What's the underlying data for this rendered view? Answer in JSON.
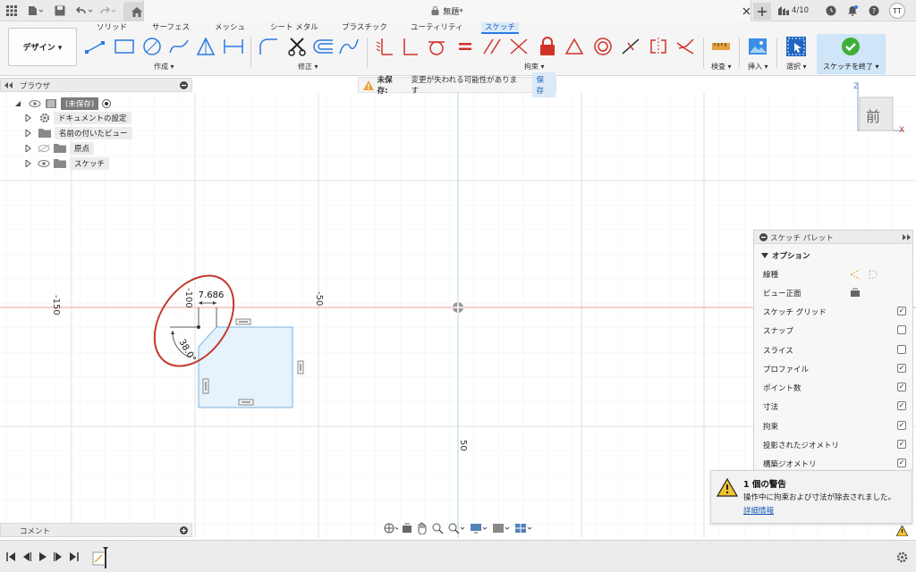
{
  "titlebar": {
    "document_title": "無題*",
    "job_counter": "4/10",
    "user_initials": "TT"
  },
  "ribbon": {
    "tabs": [
      "ソリッド",
      "サーフェス",
      "メッシュ",
      "シート メタル",
      "プラスチック",
      "ユーティリティ",
      "スケッチ"
    ],
    "active_tab": "スケッチ",
    "workspace_label": "デザイン ▾",
    "groups": {
      "create": "作成 ▾",
      "modify": "修正 ▾",
      "constraints": "拘束 ▾",
      "inspect": "検査 ▾",
      "insert": "挿入 ▾",
      "select": "選択 ▾",
      "finish": "スケッチを終了 ▾"
    }
  },
  "browser": {
    "title": "ブラウザ",
    "items": [
      {
        "label": "(未保存)"
      },
      {
        "label": "ドキュメントの設定"
      },
      {
        "label": "名前の付いたビュー"
      },
      {
        "label": "原点"
      },
      {
        "label": "スケッチ"
      }
    ]
  },
  "unsaved_bar": {
    "label": "未保存:",
    "message": "変更が失われる可能性があります",
    "save_label": "保存"
  },
  "canvas": {
    "axis_labels": {
      "x_neg150": "-150",
      "x_neg100": "-100",
      "x_neg50": "-50",
      "y_50": "50"
    },
    "dimension_length": "7.686",
    "dimension_angle": "38.0°"
  },
  "viewcube": {
    "face_label": "前",
    "axis_z": "Z",
    "axis_x": "X"
  },
  "sketch_palette": {
    "title": "スケッチ パレット",
    "section": "オプション",
    "options": [
      {
        "label": "線種",
        "type": "icons"
      },
      {
        "label": "ビュー正面",
        "type": "icon"
      },
      {
        "label": "スケッチ グリッド",
        "checked": true
      },
      {
        "label": "スナップ",
        "checked": false
      },
      {
        "label": "スライス",
        "checked": false
      },
      {
        "label": "プロファイル",
        "checked": true
      },
      {
        "label": "ポイント数",
        "checked": true
      },
      {
        "label": "寸法",
        "checked": true
      },
      {
        "label": "拘束",
        "checked": true
      },
      {
        "label": "投影されたジオメトリ",
        "checked": true
      },
      {
        "label": "構築ジオメトリ",
        "checked": true
      }
    ]
  },
  "warning_toast": {
    "title": "1 個の警告",
    "message": "操作中に拘束および寸法が除去されました。",
    "link": "詳細情報"
  },
  "comments": {
    "title": "コメント"
  },
  "colors": {
    "accent": "#2a7ae2",
    "constraint_red": "#d0322a",
    "sketch_fill": "#e6f2fc",
    "sketch_stroke": "#7bb3e6",
    "annotation_red": "#c0392b"
  }
}
